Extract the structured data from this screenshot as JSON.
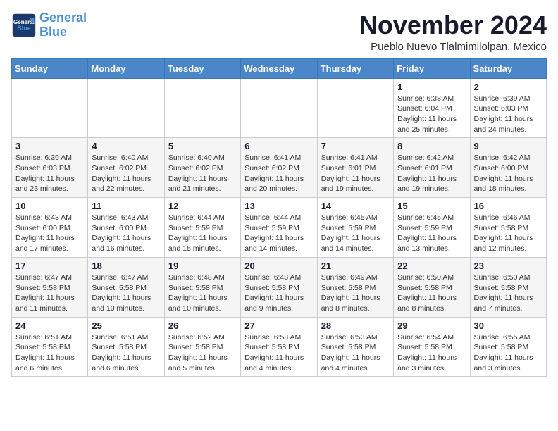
{
  "logo": {
    "line1": "General",
    "line2": "Blue"
  },
  "header": {
    "month": "November 2024",
    "location": "Pueblo Nuevo Tlalmimilolpan, Mexico"
  },
  "weekdays": [
    "Sunday",
    "Monday",
    "Tuesday",
    "Wednesday",
    "Thursday",
    "Friday",
    "Saturday"
  ],
  "weeks": [
    [
      {
        "day": "",
        "info": ""
      },
      {
        "day": "",
        "info": ""
      },
      {
        "day": "",
        "info": ""
      },
      {
        "day": "",
        "info": ""
      },
      {
        "day": "",
        "info": ""
      },
      {
        "day": "1",
        "info": "Sunrise: 6:38 AM\nSunset: 6:04 PM\nDaylight: 11 hours and 25 minutes."
      },
      {
        "day": "2",
        "info": "Sunrise: 6:39 AM\nSunset: 6:03 PM\nDaylight: 11 hours and 24 minutes."
      }
    ],
    [
      {
        "day": "3",
        "info": "Sunrise: 6:39 AM\nSunset: 6:03 PM\nDaylight: 11 hours and 23 minutes."
      },
      {
        "day": "4",
        "info": "Sunrise: 6:40 AM\nSunset: 6:02 PM\nDaylight: 11 hours and 22 minutes."
      },
      {
        "day": "5",
        "info": "Sunrise: 6:40 AM\nSunset: 6:02 PM\nDaylight: 11 hours and 21 minutes."
      },
      {
        "day": "6",
        "info": "Sunrise: 6:41 AM\nSunset: 6:02 PM\nDaylight: 11 hours and 20 minutes."
      },
      {
        "day": "7",
        "info": "Sunrise: 6:41 AM\nSunset: 6:01 PM\nDaylight: 11 hours and 19 minutes."
      },
      {
        "day": "8",
        "info": "Sunrise: 6:42 AM\nSunset: 6:01 PM\nDaylight: 11 hours and 19 minutes."
      },
      {
        "day": "9",
        "info": "Sunrise: 6:42 AM\nSunset: 6:00 PM\nDaylight: 11 hours and 18 minutes."
      }
    ],
    [
      {
        "day": "10",
        "info": "Sunrise: 6:43 AM\nSunset: 6:00 PM\nDaylight: 11 hours and 17 minutes."
      },
      {
        "day": "11",
        "info": "Sunrise: 6:43 AM\nSunset: 6:00 PM\nDaylight: 11 hours and 16 minutes."
      },
      {
        "day": "12",
        "info": "Sunrise: 6:44 AM\nSunset: 5:59 PM\nDaylight: 11 hours and 15 minutes."
      },
      {
        "day": "13",
        "info": "Sunrise: 6:44 AM\nSunset: 5:59 PM\nDaylight: 11 hours and 14 minutes."
      },
      {
        "day": "14",
        "info": "Sunrise: 6:45 AM\nSunset: 5:59 PM\nDaylight: 11 hours and 14 minutes."
      },
      {
        "day": "15",
        "info": "Sunrise: 6:45 AM\nSunset: 5:59 PM\nDaylight: 11 hours and 13 minutes."
      },
      {
        "day": "16",
        "info": "Sunrise: 6:46 AM\nSunset: 5:58 PM\nDaylight: 11 hours and 12 minutes."
      }
    ],
    [
      {
        "day": "17",
        "info": "Sunrise: 6:47 AM\nSunset: 5:58 PM\nDaylight: 11 hours and 11 minutes."
      },
      {
        "day": "18",
        "info": "Sunrise: 6:47 AM\nSunset: 5:58 PM\nDaylight: 11 hours and 10 minutes."
      },
      {
        "day": "19",
        "info": "Sunrise: 6:48 AM\nSunset: 5:58 PM\nDaylight: 11 hours and 10 minutes."
      },
      {
        "day": "20",
        "info": "Sunrise: 6:48 AM\nSunset: 5:58 PM\nDaylight: 11 hours and 9 minutes."
      },
      {
        "day": "21",
        "info": "Sunrise: 6:49 AM\nSunset: 5:58 PM\nDaylight: 11 hours and 8 minutes."
      },
      {
        "day": "22",
        "info": "Sunrise: 6:50 AM\nSunset: 5:58 PM\nDaylight: 11 hours and 8 minutes."
      },
      {
        "day": "23",
        "info": "Sunrise: 6:50 AM\nSunset: 5:58 PM\nDaylight: 11 hours and 7 minutes."
      }
    ],
    [
      {
        "day": "24",
        "info": "Sunrise: 6:51 AM\nSunset: 5:58 PM\nDaylight: 11 hours and 6 minutes."
      },
      {
        "day": "25",
        "info": "Sunrise: 6:51 AM\nSunset: 5:58 PM\nDaylight: 11 hours and 6 minutes."
      },
      {
        "day": "26",
        "info": "Sunrise: 6:52 AM\nSunset: 5:58 PM\nDaylight: 11 hours and 5 minutes."
      },
      {
        "day": "27",
        "info": "Sunrise: 6:53 AM\nSunset: 5:58 PM\nDaylight: 11 hours and 4 minutes."
      },
      {
        "day": "28",
        "info": "Sunrise: 6:53 AM\nSunset: 5:58 PM\nDaylight: 11 hours and 4 minutes."
      },
      {
        "day": "29",
        "info": "Sunrise: 6:54 AM\nSunset: 5:58 PM\nDaylight: 11 hours and 3 minutes."
      },
      {
        "day": "30",
        "info": "Sunrise: 6:55 AM\nSunset: 5:58 PM\nDaylight: 11 hours and 3 minutes."
      }
    ]
  ]
}
